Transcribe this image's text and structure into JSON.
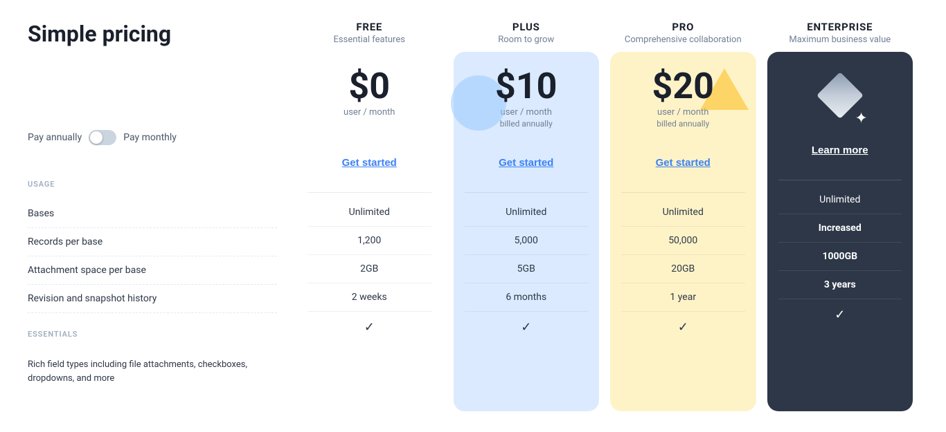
{
  "page": {
    "title": "Simple pricing"
  },
  "billing": {
    "annual_label": "Pay annually",
    "monthly_label": "Pay monthly"
  },
  "sections": {
    "usage_label": "USAGE",
    "essentials_label": "ESSENTIALS"
  },
  "features": {
    "usage": [
      {
        "label": "Bases"
      },
      {
        "label": "Records per base"
      },
      {
        "label": "Attachment space per base"
      },
      {
        "label": "Revision and snapshot history"
      }
    ],
    "essentials": [
      {
        "label": "Rich field types including file attachments, checkboxes, dropdowns, and more"
      }
    ]
  },
  "plans": [
    {
      "id": "free",
      "name": "FREE",
      "subtitle": "Essential features",
      "price": "$0",
      "price_period": "user / month",
      "price_billed": "",
      "cta": "Get started",
      "card_style": "free",
      "usage_values": [
        "Unlimited",
        "1,200",
        "2GB",
        "2 weeks"
      ],
      "has_essentials": true
    },
    {
      "id": "plus",
      "name": "PLUS",
      "subtitle": "Room to grow",
      "price": "$10",
      "price_period": "user / month",
      "price_billed": "billed annually",
      "cta": "Get started",
      "card_style": "plus",
      "usage_values": [
        "Unlimited",
        "5,000",
        "5GB",
        "6 months"
      ],
      "has_essentials": true
    },
    {
      "id": "pro",
      "name": "PRO",
      "subtitle": "Comprehensive collaboration",
      "price": "$20",
      "price_period": "user / month",
      "price_billed": "billed annually",
      "cta": "Get started",
      "card_style": "pro",
      "usage_values": [
        "Unlimited",
        "50,000",
        "20GB",
        "1 year"
      ],
      "has_essentials": true
    },
    {
      "id": "enterprise",
      "name": "ENTERPRISE",
      "subtitle": "Maximum business value",
      "price": "",
      "price_period": "",
      "price_billed": "",
      "cta": "Learn more",
      "card_style": "enterprise",
      "usage_values": [
        "Unlimited",
        "Increased",
        "1000GB",
        "3 years"
      ],
      "usage_bold": [
        false,
        true,
        true,
        true
      ],
      "has_essentials": true
    }
  ]
}
